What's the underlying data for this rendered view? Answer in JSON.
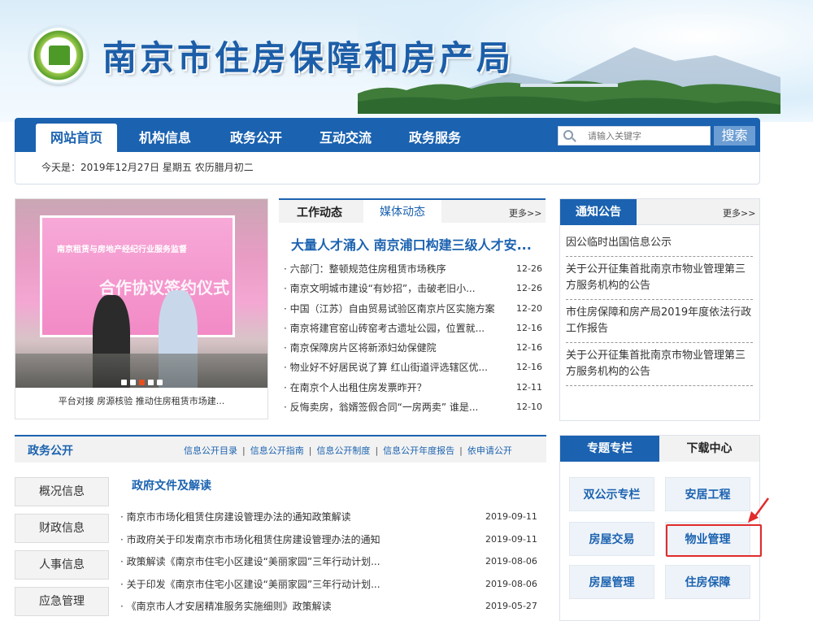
{
  "header": {
    "site_title": "南京市住房保障和房产局"
  },
  "nav": {
    "items": [
      "网站首页",
      "机构信息",
      "政务公开",
      "互动交流",
      "政务服务"
    ],
    "search_placeholder": "请输入关键字",
    "search_button": "搜索"
  },
  "datebar": {
    "text": "今天是：2019年12月27日 星期五  农历腊月初二"
  },
  "slider": {
    "caption": "平台对接 房源核验 推动住房租赁市场建...",
    "board_line1": "南京租赁与房地产经纪行业服务监督",
    "board_line2": "合作协议签约仪式",
    "dot_count": 5,
    "active_dot": 3
  },
  "news": {
    "tab1": "工作动态",
    "tab2": "媒体动态",
    "more": "更多>>",
    "headline": "大量人才涌入 南京浦口构建三级人才安...",
    "items": [
      {
        "title": "· 六部门：整顿规范住房租赁市场秩序",
        "date": "12-26"
      },
      {
        "title": "· 南京文明城市建设“有妙招”，击破老旧小...",
        "date": "12-26"
      },
      {
        "title": "· 中国（江苏）自由贸易试验区南京片区实施方案",
        "date": "12-20"
      },
      {
        "title": "· 南京将建官窑山砖窑考古遗址公园，位置就...",
        "date": "12-16"
      },
      {
        "title": "· 南京保障房片区将新添妇幼保健院",
        "date": "12-16"
      },
      {
        "title": "· 物业好不好居民说了算 红山街道评选辖区优...",
        "date": "12-16"
      },
      {
        "title": "· 在南京个人出租住房发票昨开？",
        "date": "12-11"
      },
      {
        "title": "· 反悔卖房，翁婿签假合同“一房两卖” 谁是...",
        "date": "12-10"
      }
    ]
  },
  "notice": {
    "title": "通知公告",
    "more": "更多>>",
    "items": [
      "因公临时出国信息公示",
      "关于公开征集首批南京市物业管理第三方服务机构的公告",
      "市住房保障和房产局2019年度依法行政工作报告",
      "关于公开征集首批南京市物业管理第三方服务机构的公告"
    ]
  },
  "gov": {
    "title": "政务公开",
    "links": [
      "信息公开目录",
      "信息公开指南",
      "信息公开制度",
      "信息公开年度报告",
      "依申请公开"
    ],
    "side_buttons": [
      "概况信息",
      "财政信息",
      "人事信息",
      "应急管理"
    ],
    "doc_title": "政府文件及解读",
    "docs": [
      {
        "title": "· 南京市市场化租赁住房建设管理办法的通知政策解读",
        "date": "2019-09-11"
      },
      {
        "title": "· 市政府关于印发南京市市场化租赁住房建设管理办法的通知",
        "date": "2019-09-11"
      },
      {
        "title": "· 政策解读《南京市住宅小区建设“美丽家园”三年行动计划...",
        "date": "2019-08-06"
      },
      {
        "title": "· 关于印发《南京市住宅小区建设“美丽家园”三年行动计划...",
        "date": "2019-08-06"
      },
      {
        "title": "· 《南京市人才安居精准服务实施细则》政策解读",
        "date": "2019-05-27"
      }
    ]
  },
  "topics": {
    "tab1": "专题专栏",
    "tab2": "下载中心",
    "buttons": [
      "双公示专栏",
      "安居工程",
      "房屋交易",
      "物业管理",
      "房屋管理",
      "住房保障"
    ]
  },
  "colors": {
    "brand_blue": "#1b62b0",
    "highlight_red": "#e12b2b",
    "active_dot": "#e7501e"
  }
}
